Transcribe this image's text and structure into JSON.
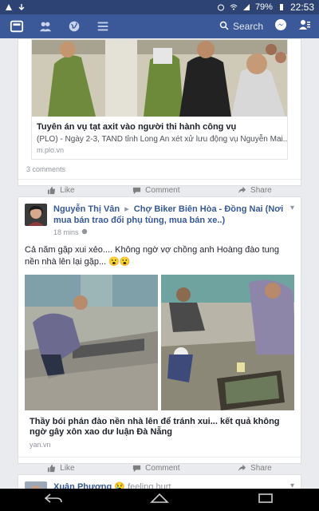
{
  "status": {
    "battery": "79%",
    "time": "22:53"
  },
  "navbar": {
    "search_label": "Search"
  },
  "posts": [
    {
      "link_title": "Tuyên án vụ tạt axit vào người thi hành công vụ",
      "link_desc": "(PLO) - Ngày 2-3, TAND tỉnh Long An xét xử lưu động vụ Nguyễn Mai...",
      "link_domain": "m.plo.vn",
      "comments": "3 comments",
      "like": "Like",
      "comment": "Comment",
      "share": "Share"
    },
    {
      "author": "Nguyễn Thị Vân",
      "group": "Chợ Biker Biên Hòa - Đồng Nai (Nơi mua bán trao đổi phụ tùng, mua bán xe..)",
      "time": "18 mins",
      "text": "Cả năm gặp xui xẻo.... Không ngờ vợ chồng anh Hoàng đào tung nền nhà lên lại gặp...",
      "emoji": "😮😮",
      "link_title": "Thầy bói phán đào nền nhà lên để tránh xui... kết quả không ngờ gây xôn xao dư luận Đà Nẵng",
      "link_domain": "yan.vn",
      "like": "Like",
      "comment": "Comment",
      "share": "Share"
    },
    {
      "author": "Xuân Phượng",
      "feeling": "feeling hurt"
    }
  ]
}
